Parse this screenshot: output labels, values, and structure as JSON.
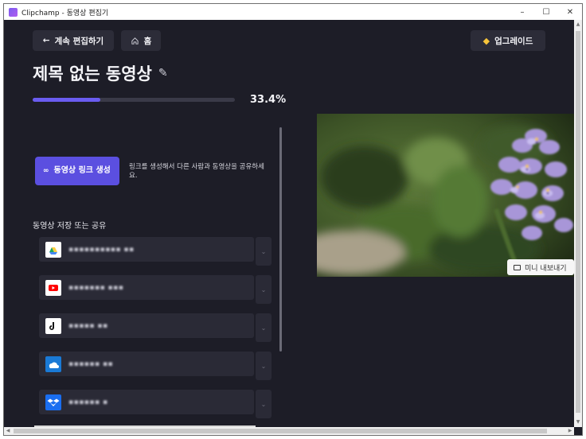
{
  "window": {
    "title": "Clipchamp - 동영상 편집기",
    "minimize": "–",
    "maximize": "☐",
    "close": "✕"
  },
  "header": {
    "back_label": "계속 편집하기",
    "home_label": "홈",
    "upgrade_label": "업그레이드"
  },
  "page": {
    "title": "제목 없는 동영상"
  },
  "export": {
    "progress_percent": 33.4,
    "progress_label": "33.4%"
  },
  "link": {
    "button_label": "동영상 링크 생성",
    "description": "링크를 생성해서 다른 사람과 동영상을 공유하세요."
  },
  "share": {
    "section_label": "동영상 저장 또는 공유",
    "items": [
      {
        "label": "▪▪▪▪▪▪▪▪▪▪ ▪▪",
        "icon": "google-drive-icon",
        "color": "#ffffff"
      },
      {
        "label": "▪▪▪▪▪▪▪ ▪▪▪",
        "icon": "youtube-icon",
        "color": "#ffffff"
      },
      {
        "label": "▪▪▪▪▪ ▪▪",
        "icon": "tiktok-icon",
        "color": "#ffffff"
      },
      {
        "label": "▪▪▪▪▪▪ ▪▪",
        "icon": "onedrive-icon",
        "color": "#1a7ad6"
      },
      {
        "label": "▪▪▪▪▪▪ ▪",
        "icon": "dropbox-icon",
        "color": "#1a6ef0"
      }
    ]
  },
  "preview": {
    "mini_export_label": "미니 내보내기"
  },
  "colors": {
    "accent": "#5b4fe0",
    "progress": "#6a5cf0",
    "background": "#1d1d27"
  }
}
